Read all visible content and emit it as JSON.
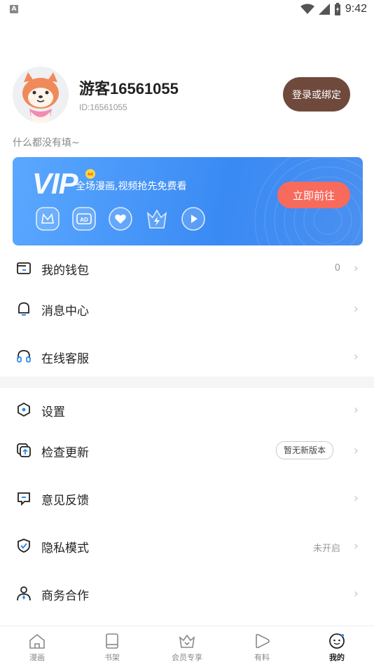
{
  "status_bar": {
    "time": "9:42"
  },
  "profile": {
    "username": "游客16561055",
    "user_id": "ID:16561055",
    "login_button": "登录或绑定",
    "bio": "什么都没有填~"
  },
  "vip": {
    "title": "VIP",
    "slogan": "全场漫画,视频抢先免费看",
    "button": "立即前往",
    "perks": [
      "m-badge-icon",
      "ad-free-icon",
      "heart-icon",
      "crown-lightning-icon",
      "play-icon"
    ]
  },
  "menu": {
    "wallet": {
      "label": "我的钱包",
      "value": "0"
    },
    "messages": {
      "label": "消息中心"
    },
    "support": {
      "label": "在线客服"
    },
    "settings": {
      "label": "设置"
    },
    "update": {
      "label": "检查更新",
      "badge": "暂无新版本"
    },
    "feedback": {
      "label": "意见反馈"
    },
    "privacy": {
      "label": "隐私模式",
      "value": "未开启"
    },
    "business": {
      "label": "商务合作"
    }
  },
  "tabs": [
    {
      "label": "漫画",
      "icon": "home-icon"
    },
    {
      "label": "书架",
      "icon": "book-icon"
    },
    {
      "label": "会员专享",
      "icon": "vip-crown-icon"
    },
    {
      "label": "有料",
      "icon": "play-icon"
    },
    {
      "label": "我的",
      "icon": "profile-face-icon",
      "active": true
    }
  ],
  "colors": {
    "accent_brown": "#6f4a3c",
    "vip_blue": "#3a8af4",
    "vip_button": "#f76a5c"
  }
}
